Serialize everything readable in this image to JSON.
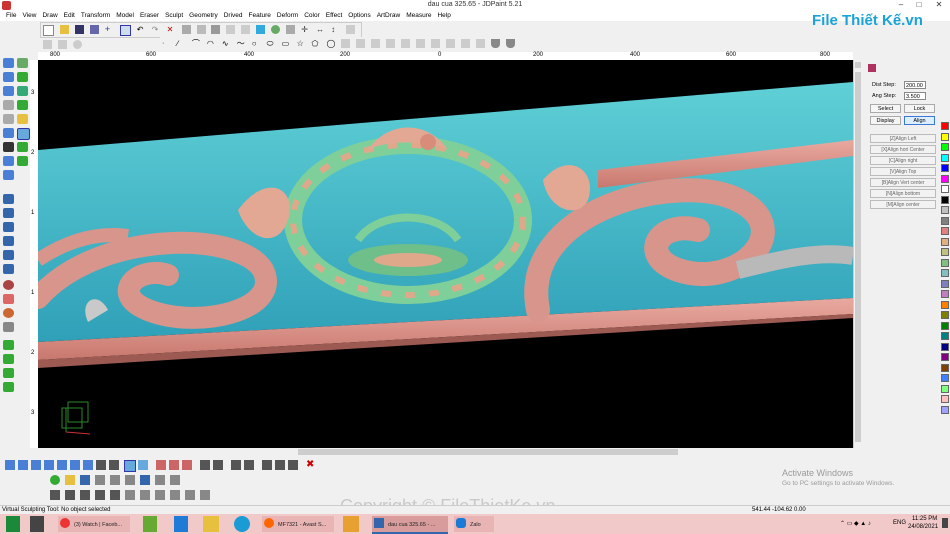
{
  "window": {
    "title": "dau cua 325.65 - JDPaint 5.21",
    "minimize": "–",
    "maximize": "□",
    "close": "✕"
  },
  "menu": [
    "File",
    "View",
    "Draw",
    "Edit",
    "Transform",
    "Model",
    "Eraser",
    "Sculpt",
    "Geometry",
    "Drived",
    "Feature",
    "Deform",
    "Color",
    "Effect",
    "Options",
    "ArtDraw",
    "Measure",
    "Help"
  ],
  "ruler": {
    "top_ticks": [
      "800",
      "600",
      "400",
      "200",
      "0",
      "200",
      "400",
      "600",
      "800"
    ],
    "left_ticks": [
      "3",
      "2",
      "1",
      "1",
      "2",
      "3"
    ]
  },
  "panel": {
    "dist_step_label": "Dist Step:",
    "dist_step_value": "200.00",
    "ang_step_label": "Ang Step:",
    "ang_step_value": "3.500",
    "select": "Select",
    "lock": "Lock",
    "display": "Display",
    "align": "Align",
    "align_buttons": [
      "[Z]Align Left",
      "[X]Align hori Center",
      "[C]Align right",
      "[V]Align Top",
      "[B]Align Vert center",
      "[N]Align bottom",
      "[M]Align center"
    ]
  },
  "status": {
    "message": "Virtual Sculpting Tool: No object selected",
    "coords": "541.44 -104.62 0.00"
  },
  "taskbar": {
    "items": [
      "(3) Watch | Faceb...",
      "MF7321 - Avast S...",
      "dau cua 325.65 - ...",
      "Zalo"
    ],
    "lang": "ENG",
    "time": "11:25 PM",
    "date": "24/08/2021"
  },
  "overlays": {
    "logo": "File Thiết Kế.vn",
    "activate_title": "Activate Windows",
    "activate_sub": "Go to PC settings to activate Windows.",
    "copyright": "Copyright © FileThietKe.vn"
  },
  "colors": {
    "swatches": [
      "#ff0000",
      "#ffff00",
      "#00ff00",
      "#00ffff",
      "#0000ff",
      "#ff00ff",
      "#ffffff",
      "#000000",
      "#c0c0c0",
      "#808080",
      "#e08080",
      "#e0b080",
      "#c0c080",
      "#80c080",
      "#80c0c0",
      "#8080c0",
      "#c080c0",
      "#ff8000",
      "#808000",
      "#008000",
      "#008080",
      "#000080",
      "#800080",
      "#804000",
      "#4080ff",
      "#80ff80",
      "#ffc0c0",
      "#a0a0ff"
    ]
  }
}
